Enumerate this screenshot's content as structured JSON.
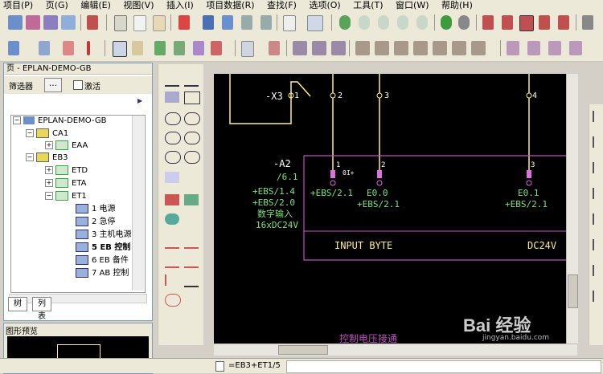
{
  "menu": [
    {
      "label": "项目(P)"
    },
    {
      "label": "页(G)"
    },
    {
      "label": "编辑(E)"
    },
    {
      "label": "视图(V)"
    },
    {
      "label": "插入(I)"
    },
    {
      "label": "项目数据(R)"
    },
    {
      "label": "查找(F)"
    },
    {
      "label": "选项(O)"
    },
    {
      "label": "工具(T)"
    },
    {
      "label": "窗口(W)"
    },
    {
      "label": "帮助(H)"
    }
  ],
  "page_panel": {
    "title": "页 - EPLAN-DEMO-GB",
    "filter_label": "筛选器",
    "filter_button": "...",
    "activate_label": "激活",
    "tree": [
      {
        "label": "EPLAN-DEMO-GB"
      },
      {
        "label": "CA1"
      },
      {
        "label": "EAA"
      },
      {
        "label": "EB3"
      },
      {
        "label": "ETD"
      },
      {
        "label": "ETA"
      },
      {
        "label": "ET1"
      },
      {
        "label": "1 电源"
      },
      {
        "label": "2 急停"
      },
      {
        "label": "3 主机电源"
      },
      {
        "label": "5 EB 控制"
      },
      {
        "label": "6 EB 备件"
      },
      {
        "label": "7 AB 控制"
      }
    ],
    "tabs": [
      {
        "label": "树"
      },
      {
        "label": "列表"
      }
    ]
  },
  "preview": {
    "title": "图形预览"
  },
  "status": {
    "page": "=EB3+ET1/5"
  },
  "schematic": {
    "terminal_label": "-X3",
    "terminal_numbers": [
      "1",
      "2",
      "3",
      "4"
    ],
    "device_label": "-A2",
    "device_ref": "/6.1",
    "device_refs_left": [
      "+EBS/1.4",
      "+EBS/2.0"
    ],
    "device_desc": [
      "数字输入",
      "16xDC24V"
    ],
    "io_numbers": [
      "1",
      "2",
      "3"
    ],
    "io_sublabel": "0I+",
    "io_names": [
      "+EBS/2.1",
      "E0.0",
      "E0.1"
    ],
    "io_refs": [
      "+EBS/2.1",
      "+EBS/2.1"
    ],
    "box_left_text": "INPUT BYTE",
    "box_right_text": "DC24V",
    "bottom_text": "控制电压接通"
  },
  "watermark": {
    "text": "Bai 经验",
    "sub": "jingyan.baidu.com"
  }
}
